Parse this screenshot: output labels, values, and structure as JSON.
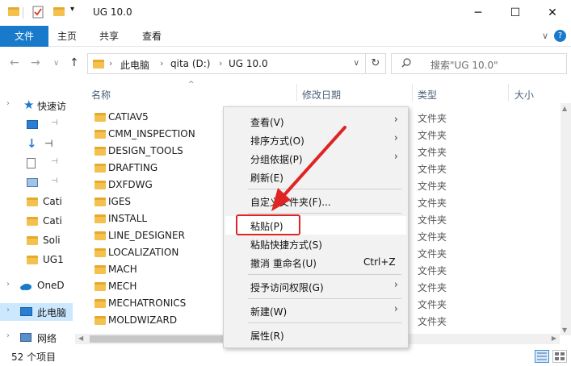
{
  "window": {
    "title": "UG 10.0",
    "minimize": "─",
    "maximize": "☐",
    "close": "✕"
  },
  "ribbon": {
    "tabs": [
      "文件",
      "主页",
      "共享",
      "查看"
    ],
    "collapse_glyph": "∨",
    "help_glyph": "?"
  },
  "nav": {
    "back": "←",
    "forward": "→",
    "recent": "∨",
    "up": "↑",
    "crumbs": [
      "此电脑",
      "qita (D:)",
      "UG 10.0"
    ],
    "crumb_sep": "›",
    "dropdown": "∨",
    "refresh": "↻",
    "search_placeholder": "搜索\"UG 10.0\""
  },
  "sidebar": {
    "items": [
      {
        "label": "快速访",
        "icon": "star-icon"
      },
      {
        "label": "",
        "icon": "desktop-icon"
      },
      {
        "label": "",
        "icon": "download-icon"
      },
      {
        "label": "",
        "icon": "document-icon"
      },
      {
        "label": "",
        "icon": "picture-icon"
      },
      {
        "label": "Cati",
        "icon": "folder-icon"
      },
      {
        "label": "Cati",
        "icon": "folder-icon"
      },
      {
        "label": "Soli",
        "icon": "folder-icon"
      },
      {
        "label": "UG1",
        "icon": "folder-icon"
      },
      {
        "label": "OneD",
        "icon": "onedrive-icon"
      },
      {
        "label": "此电脑",
        "icon": "pc-icon"
      },
      {
        "label": "网络",
        "icon": "network-icon"
      }
    ],
    "pin_glyph": "⊣",
    "chev_glyph": "›"
  },
  "columns": {
    "name": "名称",
    "modified": "修改日期",
    "type": "类型",
    "size": "大小",
    "sort_caret": "^"
  },
  "files": [
    {
      "name": "CATIAV5",
      "type": "文件夹"
    },
    {
      "name": "CMM_INSPECTION",
      "type": "文件夹"
    },
    {
      "name": "DESIGN_TOOLS",
      "type": "文件夹"
    },
    {
      "name": "DRAFTING",
      "type": "文件夹"
    },
    {
      "name": "DXFDWG",
      "type": "文件夹"
    },
    {
      "name": "IGES",
      "type": "文件夹"
    },
    {
      "name": "INSTALL",
      "type": "文件夹"
    },
    {
      "name": "LINE_DESIGNER",
      "type": "文件夹"
    },
    {
      "name": "LOCALIZATION",
      "type": "文件夹"
    },
    {
      "name": "MACH",
      "type": "文件夹"
    },
    {
      "name": "MECH",
      "type": "文件夹"
    },
    {
      "name": "MECHATRONICS",
      "type": "文件夹"
    },
    {
      "name": "MOLDWIZARD",
      "type": "文件夹"
    }
  ],
  "status": {
    "count": "52 个项目"
  },
  "context_menu": {
    "items": [
      {
        "label": "查看(V)",
        "submenu": "›"
      },
      {
        "label": "排序方式(O)",
        "submenu": "›"
      },
      {
        "label": "分组依据(P)",
        "submenu": "›"
      },
      {
        "label": "刷新(E)"
      },
      {
        "label": "自定义文件夹(F)..."
      },
      {
        "label": "粘贴(P)"
      },
      {
        "label": "粘贴快捷方式(S)"
      },
      {
        "label": "撤消 重命名(U)",
        "shortcut": "Ctrl+Z"
      },
      {
        "label": "授予访问权限(G)",
        "submenu": "›"
      },
      {
        "label": "新建(W)",
        "submenu": "›"
      },
      {
        "label": "属性(R)"
      }
    ]
  },
  "colors": {
    "accent": "#1979ca",
    "folder": "#f2c14e",
    "highlight_red": "#e02424",
    "selection": "#cce8ff"
  }
}
